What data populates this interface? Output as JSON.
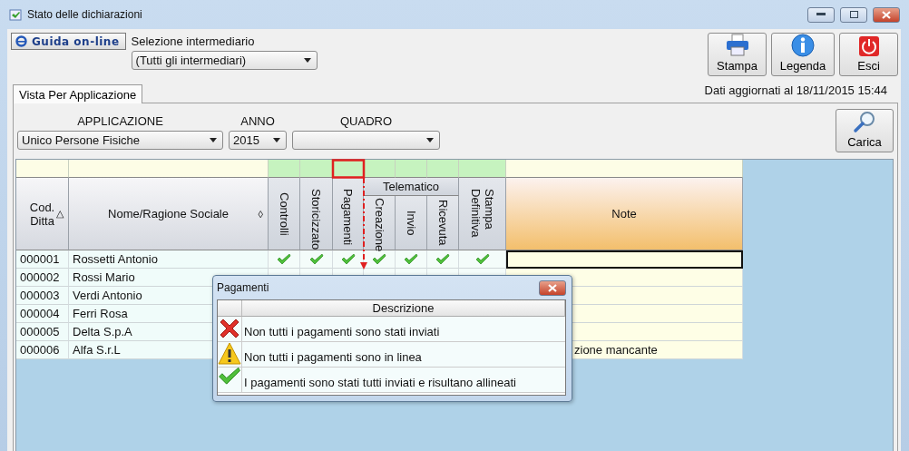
{
  "window": {
    "title": "Stato delle dichiarazioni"
  },
  "toolbar": {
    "help_button": "Guida on-line",
    "intermediary": {
      "label": "Selezione intermediario",
      "value": "(Tutti gli intermediari)"
    },
    "buttons": [
      {
        "label": "Stampa",
        "kind": "print"
      },
      {
        "label": "Legenda",
        "kind": "info"
      },
      {
        "label": "Esci",
        "kind": "exit"
      }
    ]
  },
  "tabs": [
    {
      "label": "Vista Per Applicazione",
      "selected": true
    }
  ],
  "updated": "Dati aggiornati al 18/11/2015 15:44",
  "filters": [
    {
      "label": "APPLICAZIONE",
      "value": "Unico Persone Fisiche"
    },
    {
      "label": "ANNO",
      "value": "2015"
    },
    {
      "label": "QUADRO"
    }
  ],
  "load_button": "Carica",
  "grid": {
    "columns": [
      {
        "label": "Cod. Ditta",
        "kind": "text",
        "sort_mark": "△"
      },
      {
        "label": "Nome/Ragione Sociale",
        "kind": "text",
        "sort_mark": "◊"
      },
      {
        "label": "Controlli",
        "kind": "check"
      },
      {
        "label": "Storicizzato",
        "kind": "check"
      },
      {
        "label": "Pagamenti",
        "kind": "check"
      },
      {
        "label": "Telematico",
        "kind": "group",
        "children": [
          {
            "label": "Creazione",
            "kind": "check"
          },
          {
            "label": "Invio",
            "kind": "check"
          },
          {
            "label": "Ricevuta",
            "kind": "check"
          }
        ]
      },
      {
        "label": "Stampa Definitiva",
        "kind": "check"
      },
      {
        "label": "Note",
        "kind": "note"
      }
    ],
    "rows": [
      {
        "code": "000001",
        "name": "Rossetti Antonio",
        "checks": [
          {
            "kind": "ok"
          },
          {
            "kind": "ok"
          },
          {
            "kind": "ok"
          },
          {
            "kind": "ok"
          },
          {
            "kind": "ok"
          },
          {
            "kind": "ok"
          },
          {
            "kind": "ok"
          }
        ],
        "selected": true
      },
      {
        "code": "000002",
        "name": "Rossi Mario",
        "selected": false
      },
      {
        "code": "000003",
        "name": "Verdi Antonio",
        "selected": false
      },
      {
        "code": "000004",
        "name": "Ferri Rosa",
        "selected": false
      },
      {
        "code": "000005",
        "name": "Delta S.p.A",
        "selected": false
      },
      {
        "code": "000006",
        "name": "Alfa S.r.L",
        "note": "zione mancante",
        "selected": false
      }
    ]
  },
  "legend_popup": {
    "title": "Pagamenti",
    "column": "Descrizione",
    "items": [
      {
        "kind": "error",
        "text": "Non tutti i pagamenti sono stati inviati"
      },
      {
        "kind": "warning",
        "text": "Non tutti i pagamenti sono in linea"
      },
      {
        "kind": "ok",
        "text": "I pagamenti sono stati tutti inviati e risultano allineati"
      }
    ]
  }
}
